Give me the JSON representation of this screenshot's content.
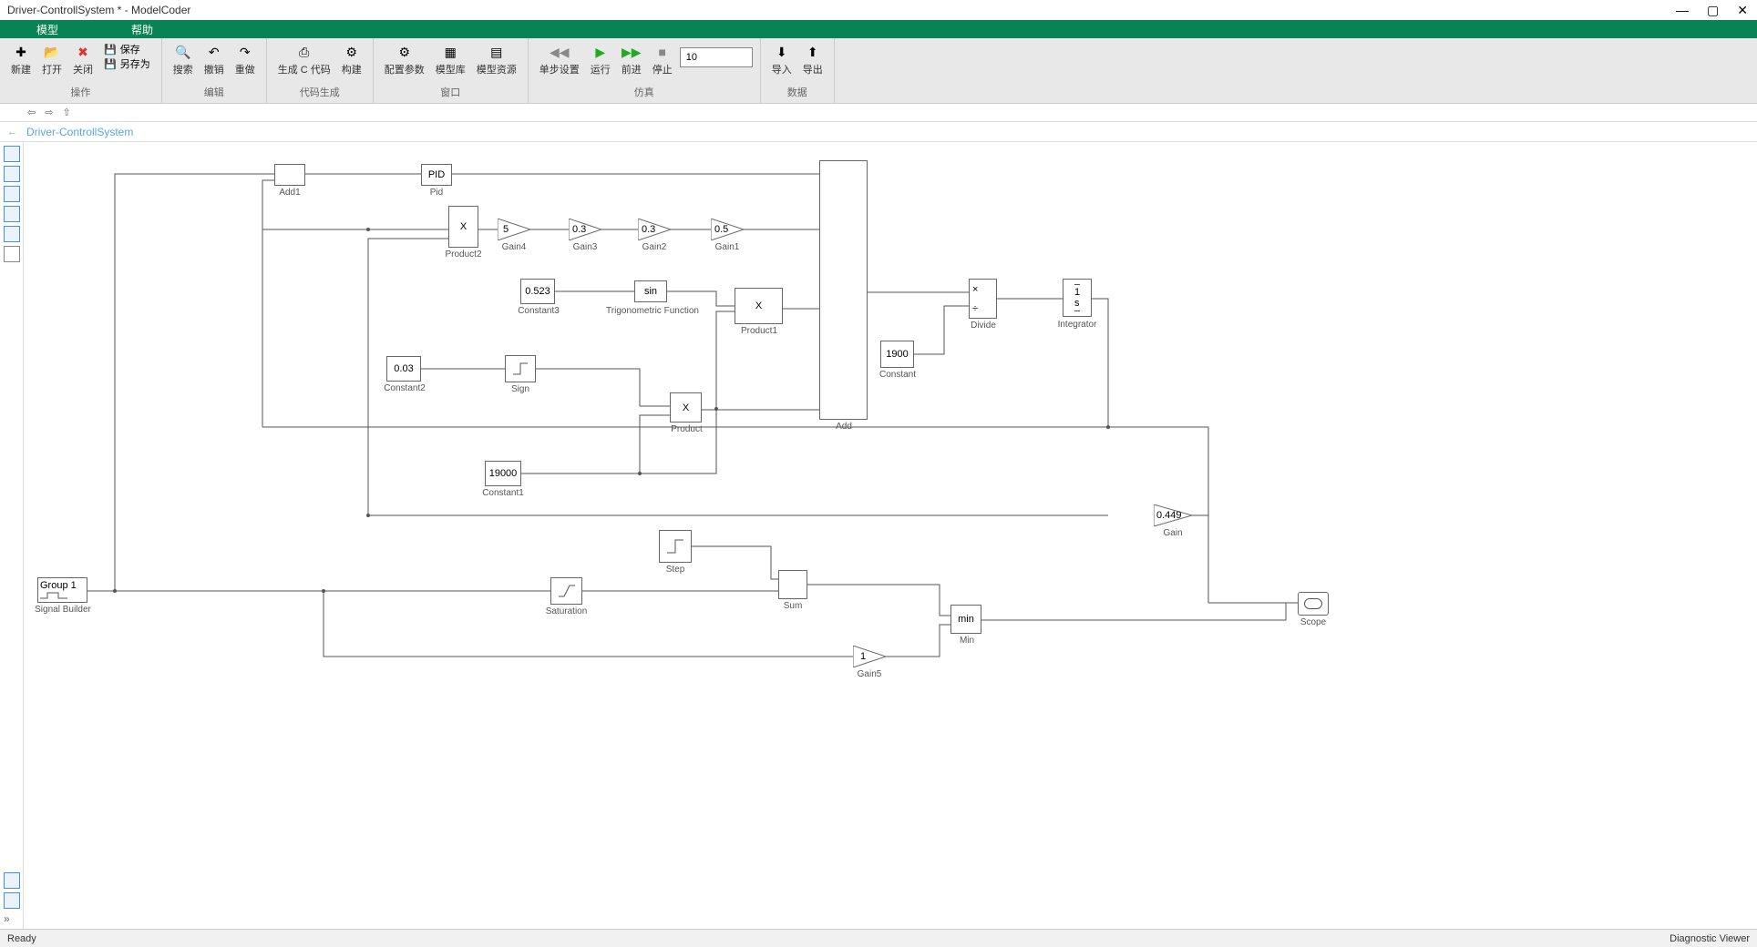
{
  "title": "Driver-ControllSystem * - ModelCoder",
  "menu": {
    "model": "模型",
    "help": "帮助"
  },
  "toolbar": {
    "new": "新建",
    "open": "打开",
    "close": "关闭",
    "save": "保存",
    "saveas": "另存为",
    "search": "搜索",
    "undo": "撤销",
    "redo": "重做",
    "genc": "生成 C 代码",
    "build": "构建",
    "configParams": "配置参数",
    "modelLib": "模型库",
    "modelRes": "模型资源",
    "step": "单步设置",
    "run": "运行",
    "forward": "前进",
    "stop": "停止",
    "import": "导入",
    "export": "导出",
    "groups": {
      "ops": "操作",
      "edit": "编辑",
      "codegen": "代码生成",
      "window": "窗口",
      "sim": "仿真",
      "data": "数据"
    },
    "simtime": "10"
  },
  "breadcrumb": {
    "path": "Driver-ControllSystem"
  },
  "blocks": {
    "add1": "Add1",
    "pid": "PID",
    "pidlbl": "Pid",
    "product2": "Product2",
    "product2sym": "X",
    "gain4": "5",
    "gain4lbl": "Gain4",
    "gain3": "0.3",
    "gain3lbl": "Gain3",
    "gain2": "0.3",
    "gain2lbl": "Gain2",
    "gain1": "0.5",
    "gain1lbl": "Gain1",
    "const3": "0.523",
    "const3lbl": "Constant3",
    "trig": "sin",
    "triglbl": "Trigonometric Function",
    "product1": "X",
    "product1lbl": "Product1",
    "const2": "0.03",
    "const2lbl": "Constant2",
    "signlbl": "Sign",
    "product": "X",
    "productlbl": "Product",
    "const1": "19000",
    "const1lbl": "Constant1",
    "add": "Add",
    "const": "1900",
    "constlbl": "Constant",
    "divide": "Divide",
    "integrator": "Integrator",
    "integratorsym": "1/s",
    "gain": "0.449",
    "gainlbl": "Gain",
    "sigbuilder": "Group 1",
    "sigbuilderlbl": "Signal Builder",
    "saturationlbl": "Saturation",
    "steplbl": "Step",
    "sumlbl": "Sum",
    "min": "min",
    "minlbl": "Min",
    "gain5": "1",
    "gain5lbl": "Gain5",
    "scopelbl": "Scope"
  },
  "status": {
    "ready": "Ready",
    "diag": "Diagnostic Viewer"
  }
}
